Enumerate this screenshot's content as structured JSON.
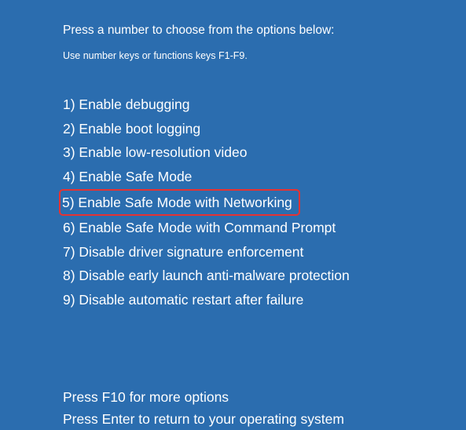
{
  "header": "Press a number to choose from the options below:",
  "subheader": "Use number keys or functions keys F1-F9.",
  "options": [
    "1) Enable debugging",
    "2) Enable boot logging",
    "3) Enable low-resolution video",
    "4) Enable Safe Mode",
    "5) Enable Safe Mode with Networking",
    "6) Enable Safe Mode with Command Prompt",
    "7) Disable driver signature enforcement",
    "8) Disable early launch anti-malware protection",
    "9) Disable automatic restart after failure"
  ],
  "highlighted_index": 4,
  "footer": {
    "line1": "Press F10 for more options",
    "line2": "Press Enter to return to your operating system"
  }
}
